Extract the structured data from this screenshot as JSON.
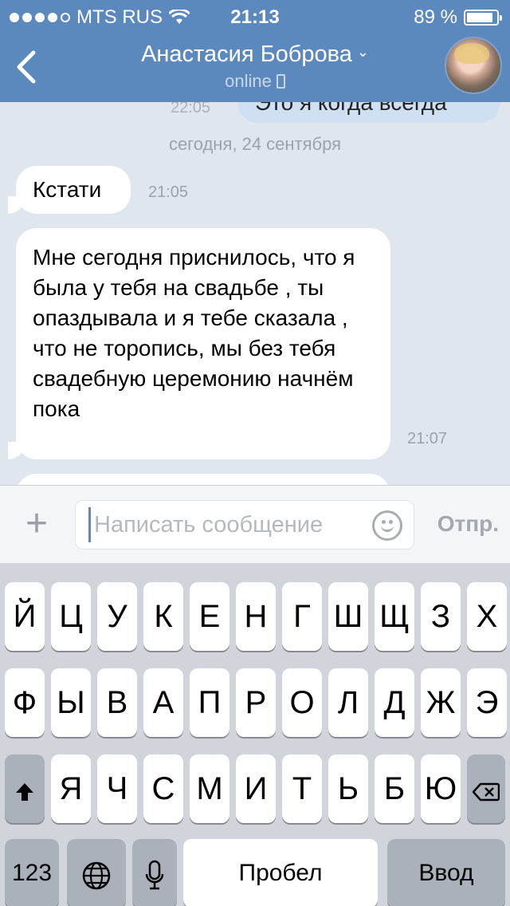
{
  "status_bar": {
    "carrier": "MTS RUS",
    "time": "21:13",
    "battery_percent": "89 %",
    "battery_level": 0.89
  },
  "header": {
    "back_icon": "chevron-left-icon",
    "title": "Анастасия Боброва",
    "title_chevron": "⌄",
    "status": "online",
    "status_icon": "phone-icon"
  },
  "chat": {
    "previous": {
      "text": "Это я когда всегда",
      "time": "22:05"
    },
    "date_separator": "сегодня, 24 сентября",
    "messages": [
      {
        "text": "Кстати",
        "time": "21:05"
      },
      {
        "text": "Мне сегодня приснилось, что я была у тебя на свадьбе , ты опаздывала и я тебе сказала , что не торопись, мы без тебя свадебную церемонию начнём пока",
        "time": "21:07"
      }
    ]
  },
  "input": {
    "placeholder": "Написать сообщение",
    "value": "",
    "send_label": "Отпр.",
    "plus_label": "+"
  },
  "keyboard": {
    "row1": [
      "Й",
      "Ц",
      "У",
      "К",
      "Е",
      "Н",
      "Г",
      "Ш",
      "Щ",
      "З",
      "Х"
    ],
    "row2": [
      "Ф",
      "Ы",
      "В",
      "А",
      "П",
      "Р",
      "О",
      "Л",
      "Д",
      "Ж",
      "Э"
    ],
    "row3": [
      "Я",
      "Ч",
      "С",
      "М",
      "И",
      "Т",
      "Ь",
      "Б",
      "Ю"
    ],
    "numbers_label": "123",
    "space_label": "Пробел",
    "return_label": "Ввод"
  }
}
